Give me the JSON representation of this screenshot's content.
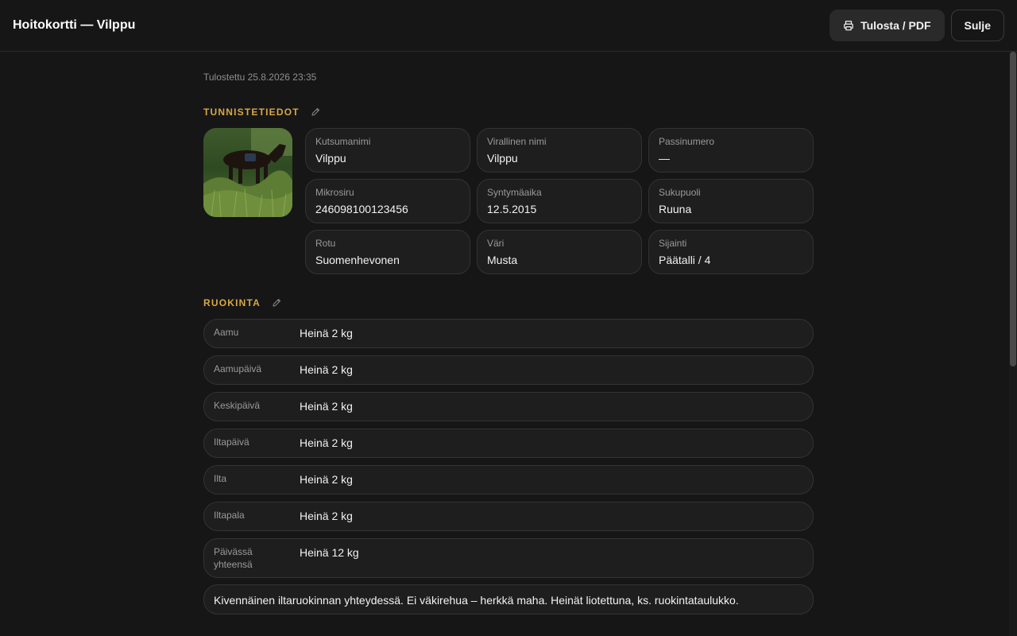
{
  "header": {
    "title": "Hoitokortti — Vilppu",
    "print_label": "Tulosta / PDF",
    "close_label": "Sulje"
  },
  "printed": "Tulostettu 25.8.2026 23:35",
  "identity": {
    "title": "TUNNISTETIEDOT",
    "fields": [
      {
        "label": "Kutsumanimi",
        "value": "Vilppu"
      },
      {
        "label": "Virallinen nimi",
        "value": "Vilppu"
      },
      {
        "label": "Passinumero",
        "value": "—"
      },
      {
        "label": "Mikrosiru",
        "value": "246098100123456"
      },
      {
        "label": "Syntymäaika",
        "value": "12.5.2015"
      },
      {
        "label": "Sukupuoli",
        "value": "Ruuna"
      },
      {
        "label": "Rotu",
        "value": "Suomenhevonen"
      },
      {
        "label": "Väri",
        "value": "Musta"
      },
      {
        "label": "Sijainti",
        "value": "Päätalli / 4"
      }
    ]
  },
  "feeding": {
    "title": "RUOKINTA",
    "rows": [
      {
        "label": "Aamu",
        "value": "Heinä 2 kg"
      },
      {
        "label": "Aamupäivä",
        "value": "Heinä 2 kg"
      },
      {
        "label": "Keskipäivä",
        "value": "Heinä 2 kg"
      },
      {
        "label": "Iltapäivä",
        "value": "Heinä 2 kg"
      },
      {
        "label": "Ilta",
        "value": "Heinä 2 kg"
      },
      {
        "label": "Iltapala",
        "value": "Heinä 2 kg"
      },
      {
        "label": "Päivässä yhteensä",
        "value": "Heinä 12 kg"
      }
    ],
    "note": "Kivennäinen iltaruokinnan yhteydessä. Ei väkirehua – herkkä maha. Heinät liotettuna, ks. ruokintataulukko."
  }
}
